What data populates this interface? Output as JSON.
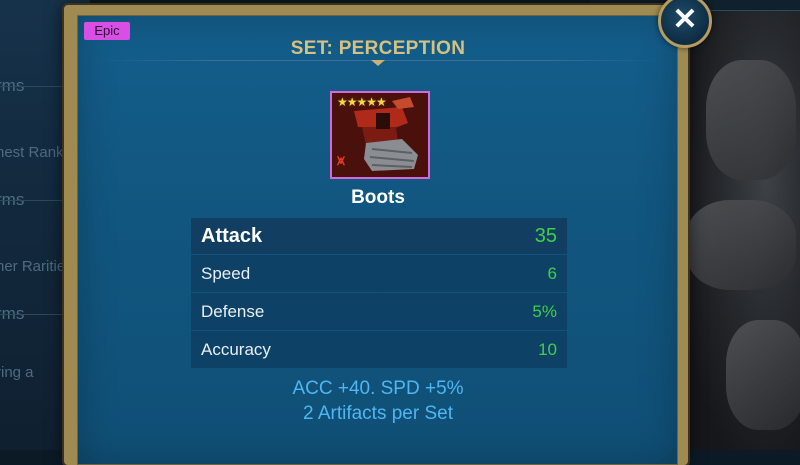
{
  "background": {
    "left_texts": [
      "rms",
      "nest Rank",
      "rms",
      "her Rarities",
      "rms",
      "ring a"
    ]
  },
  "dialog": {
    "rarity": "Epic",
    "rarity_color": "#d94fe6",
    "title": "SET: PERCEPTION",
    "close_icon": "close-icon",
    "close_symbol": "✕"
  },
  "item": {
    "name": "Boots",
    "stars": "★★★★★",
    "star_count": 5,
    "set_icon": "perception-set-icon",
    "set_symbol": "⩙"
  },
  "stats": [
    {
      "name": "Attack",
      "value": "35"
    },
    {
      "name": "Speed",
      "value": "6"
    },
    {
      "name": "Defense",
      "value": "5%"
    },
    {
      "name": "Accuracy",
      "value": "10"
    }
  ],
  "set_bonus": {
    "effect": "ACC +40. SPD +5%",
    "requirement": "2 Artifacts per Set"
  },
  "colors": {
    "title": "#d6c181",
    "stat_value": "#3fcf4b",
    "bonus_text": "#4fb6f0",
    "frame_gold": "#9f8a52"
  }
}
